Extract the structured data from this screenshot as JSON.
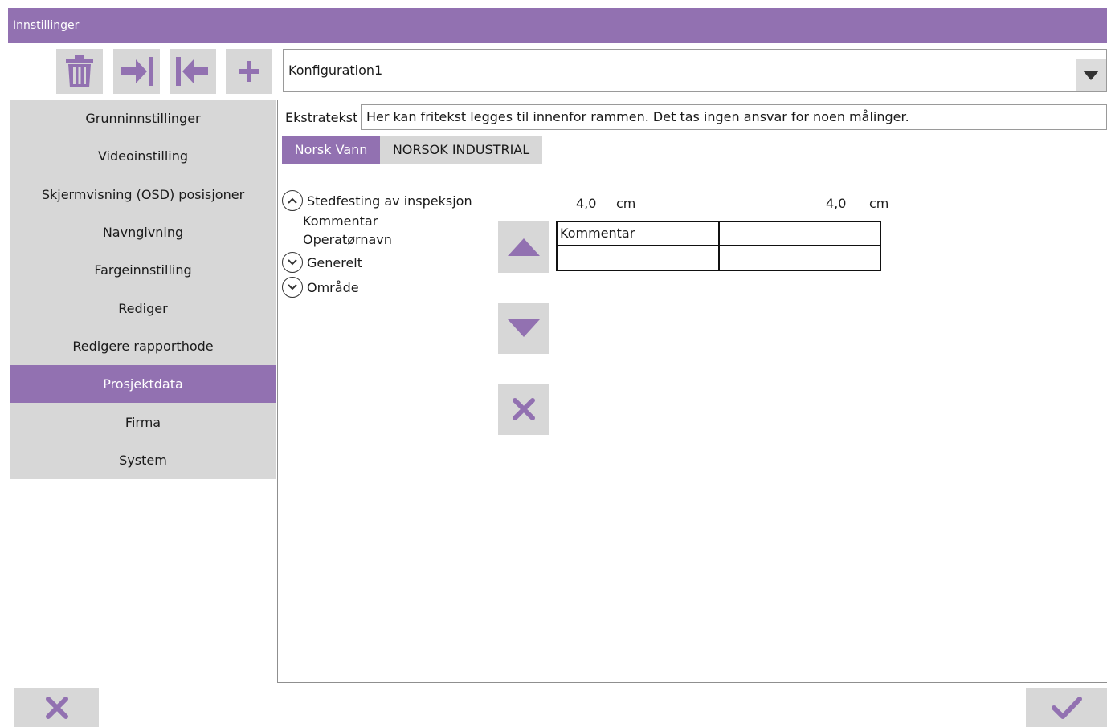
{
  "window": {
    "title": "Innstillinger"
  },
  "toolbar": {
    "delete_icon": "trash-icon",
    "import_icon": "import-arrow-icon",
    "export_icon": "export-arrow-icon",
    "add_icon": "plus-icon"
  },
  "config": {
    "selected": "Konfiguration1"
  },
  "sidebar": {
    "items": [
      {
        "label": "Grunninnstillinger",
        "active": false
      },
      {
        "label": "Videoinstilling",
        "active": false
      },
      {
        "label": "Skjermvisning (OSD) posisjoner",
        "active": false
      },
      {
        "label": "Navngivning",
        "active": false
      },
      {
        "label": "Fargeinnstilling",
        "active": false
      },
      {
        "label": "Rediger",
        "active": false
      },
      {
        "label": "Redigere rapporthode",
        "active": false
      },
      {
        "label": "Prosjektdata",
        "active": true
      },
      {
        "label": "Firma",
        "active": false
      },
      {
        "label": "System",
        "active": false
      }
    ]
  },
  "extra_text": {
    "label": "Ekstratekst",
    "value": "Her kan fritekst legges til innenfor rammen. Det tas ingen ansvar for noen målinger."
  },
  "tabs": [
    {
      "label": "Norsk Vann",
      "active": true
    },
    {
      "label": "NORSOK INDUSTRIAL",
      "active": false
    }
  ],
  "tree": {
    "group1": {
      "label": "Stedfesting av inspeksjon",
      "expanded": true,
      "children": [
        "Kommentar",
        "Operatørnavn"
      ]
    },
    "group2": {
      "label": "Generelt",
      "expanded": false
    },
    "group3": {
      "label": "Område",
      "expanded": false
    }
  },
  "dimensions": {
    "col1_value": "4,0",
    "col1_unit": "cm",
    "col2_value": "4,0",
    "col2_unit": "cm"
  },
  "grid": {
    "r1c1": "Kommentar",
    "r1c2": "",
    "r2c1": "",
    "r2c2": ""
  },
  "colors": {
    "accent": "#9271b1",
    "button_bg": "#d7d7d7"
  }
}
